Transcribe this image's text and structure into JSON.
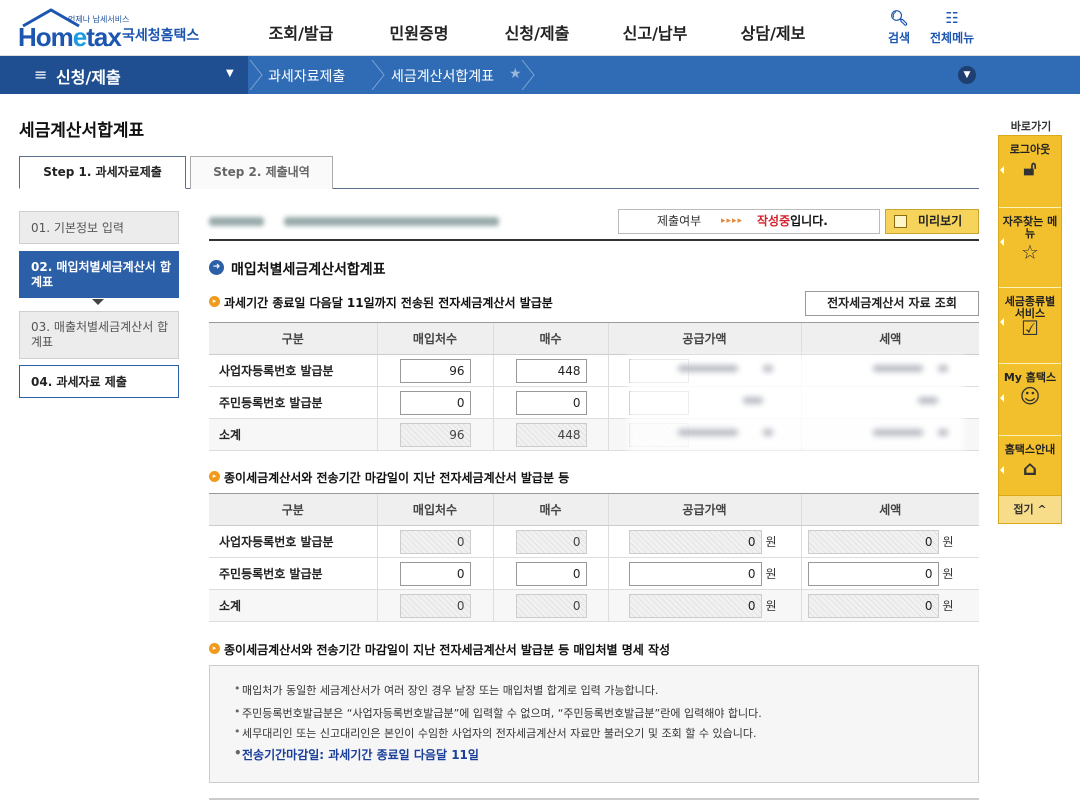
{
  "header": {
    "logo_tagline": "언제나 납세서비스",
    "logo_word_a": "Hom",
    "logo_word_e": "e",
    "logo_word_b": "tax",
    "logo_korean": "국세청홈택스",
    "nav": [
      "조회/발급",
      "민원증명",
      "신청/제출",
      "신고/납부",
      "상담/제보"
    ],
    "search_label": "검색",
    "allmenu_label": "전체메뉴"
  },
  "bar": {
    "menu_label": "신청/제출",
    "crumbs": [
      "과세자료제출",
      "세금계산서합계표"
    ]
  },
  "page_title": "세금계산서합계표",
  "tabs": [
    "Step 1. 과세자료제출",
    "Step 2. 제출내역"
  ],
  "steps": [
    "01. 기본정보 입력",
    "02. 매입처별세금계산서 합계표",
    "03. 매출처별세금계산서 합계표",
    "04. 과세자료 제출"
  ],
  "status": {
    "label": "제출여부",
    "arrows": "▸▸▸▸",
    "value_em": "작성중",
    "value_rest": "입니다.",
    "preview_label": "미리보기"
  },
  "section_title": "매입처별세금계산서합계표",
  "sub1": {
    "title": "과세기간 종료일 다음달 11일까지 전송된 전자세금계산서 발급분",
    "lookup_label": "전자세금계산서 자료 조회",
    "headers": [
      "구분",
      "매입처수",
      "매수",
      "공급가액",
      "세액"
    ],
    "rows": [
      {
        "label": "사업자등록번호 발급분",
        "count": "96",
        "sheets": "448"
      },
      {
        "label": "주민등록번호 발급분",
        "count": "0",
        "sheets": "0"
      },
      {
        "label": "소계",
        "count": "96",
        "sheets": "448"
      }
    ]
  },
  "sub2": {
    "title": "종이세금계산서와 전송기간 마감일이 지난 전자세금계산서 발급분 등",
    "headers": [
      "구분",
      "매입처수",
      "매수",
      "공급가액",
      "세액"
    ],
    "unit": "원",
    "rows": [
      {
        "label": "사업자등록번호 발급분",
        "count": "0",
        "sheets": "0",
        "supply": "0",
        "tax": "0"
      },
      {
        "label": "주민등록번호 발급분",
        "count": "0",
        "sheets": "0",
        "supply": "0",
        "tax": "0"
      },
      {
        "label": "소계",
        "count": "0",
        "sheets": "0",
        "supply": "0",
        "tax": "0"
      }
    ]
  },
  "sub3": {
    "title": "종이세금계산서와 전송기간 마감일이 지난 전자세금계산서 발급분 등 매입처별 명세 작성"
  },
  "notes": [
    "매입처가 동일한 세금계산서가 여러 장인 경우 낱장 또는 매입처별 합계로 입력 가능합니다.",
    "주민등록번호발급분은 “사업자등록번호발급분”에 입력할 수 없으며, “주민등록번호발급분”란에 입력해야 합니다.",
    "세무대리인 또는 신고대리인은 본인이 수임한 사업자의 전자세금계산서 자료만 불러오기 및 조회 할 수 있습니다.",
    "전송기간마감일: 과세기간 종료일 다음달 11일"
  ],
  "quick": {
    "title": "바로가기",
    "items": [
      "로그아웃",
      "자주찾는 메뉴",
      "세금종류별 서비스",
      "My 홈택스",
      "홈택스안내"
    ],
    "fold_label": "접기 ^"
  },
  "colors": {
    "brand_blue": "#2f6cb5",
    "brand_dark": "#1f4f91",
    "accent_yellow": "#f3c02d",
    "status_red": "#d4202a"
  }
}
